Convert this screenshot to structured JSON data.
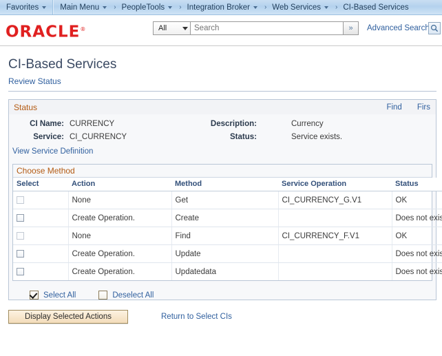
{
  "topnav": {
    "items": [
      {
        "label": "Favorites",
        "caret": true,
        "arrow": false
      },
      {
        "label": "Main Menu",
        "caret": true,
        "arrow": false
      },
      {
        "label": "PeopleTools",
        "caret": true,
        "arrow": true
      },
      {
        "label": "Integration Broker",
        "caret": true,
        "arrow": true
      },
      {
        "label": "Web Services",
        "caret": true,
        "arrow": true
      },
      {
        "label": "CI-Based Services",
        "caret": false,
        "arrow": true
      }
    ]
  },
  "brandbar": {
    "logo": "ORACLE",
    "logo_mark": "®",
    "scope_selected": "All",
    "search_placeholder": "Search",
    "search_value": "",
    "go_label": "»",
    "advanced_search": "Advanced Search",
    "magnifier_icon": "search-icon"
  },
  "page": {
    "title": "CI-Based Services",
    "subtitle": "Review Status"
  },
  "status_panel": {
    "label": "Status",
    "links": [
      {
        "label": "Find"
      },
      {
        "label": "Firs"
      }
    ],
    "fields": {
      "ci_name_label": "CI Name:",
      "ci_name_value": "CURRENCY",
      "service_label": "Service:",
      "service_value": "CI_CURRENCY",
      "description_label": "Description:",
      "description_value": "Currency",
      "status_label": "Status:",
      "status_value": "Service exists."
    },
    "view_service_definition": "View Service Definition"
  },
  "choose_method": {
    "label": "Choose Method",
    "columns": [
      "Select",
      "Action",
      "Method",
      "Service Operation",
      "Status"
    ],
    "rows": [
      {
        "selected": false,
        "enabled": false,
        "action": "None",
        "method": "Get",
        "service_operation": "CI_CURRENCY_G.V1",
        "status": "OK"
      },
      {
        "selected": false,
        "enabled": true,
        "action": "Create Operation.",
        "method": "Create",
        "service_operation": "",
        "status": "Does not exist."
      },
      {
        "selected": false,
        "enabled": false,
        "action": "None",
        "method": "Find",
        "service_operation": "CI_CURRENCY_F.V1",
        "status": "OK"
      },
      {
        "selected": false,
        "enabled": true,
        "action": "Create Operation.",
        "method": "Update",
        "service_operation": "",
        "status": "Does not exist."
      },
      {
        "selected": false,
        "enabled": true,
        "action": "Create Operation.",
        "method": "Updatedata",
        "service_operation": "",
        "status": "Does not exist."
      }
    ]
  },
  "bulk_select": {
    "select_all_label": "Select All",
    "select_all_checked": true,
    "deselect_all_label": "Deselect All",
    "deselect_all_checked": false
  },
  "actions": {
    "display_selected_label": "Display Selected Actions",
    "return_link_label": "Return to Select CIs"
  },
  "colors": {
    "brand_red": "#e02020",
    "link_blue": "#2f5f9e",
    "group_label_orange": "#b35a12",
    "nav_blue": "#b4d2ee",
    "title_navy": "#3b4a63",
    "button_tan": "#f3dcba"
  }
}
